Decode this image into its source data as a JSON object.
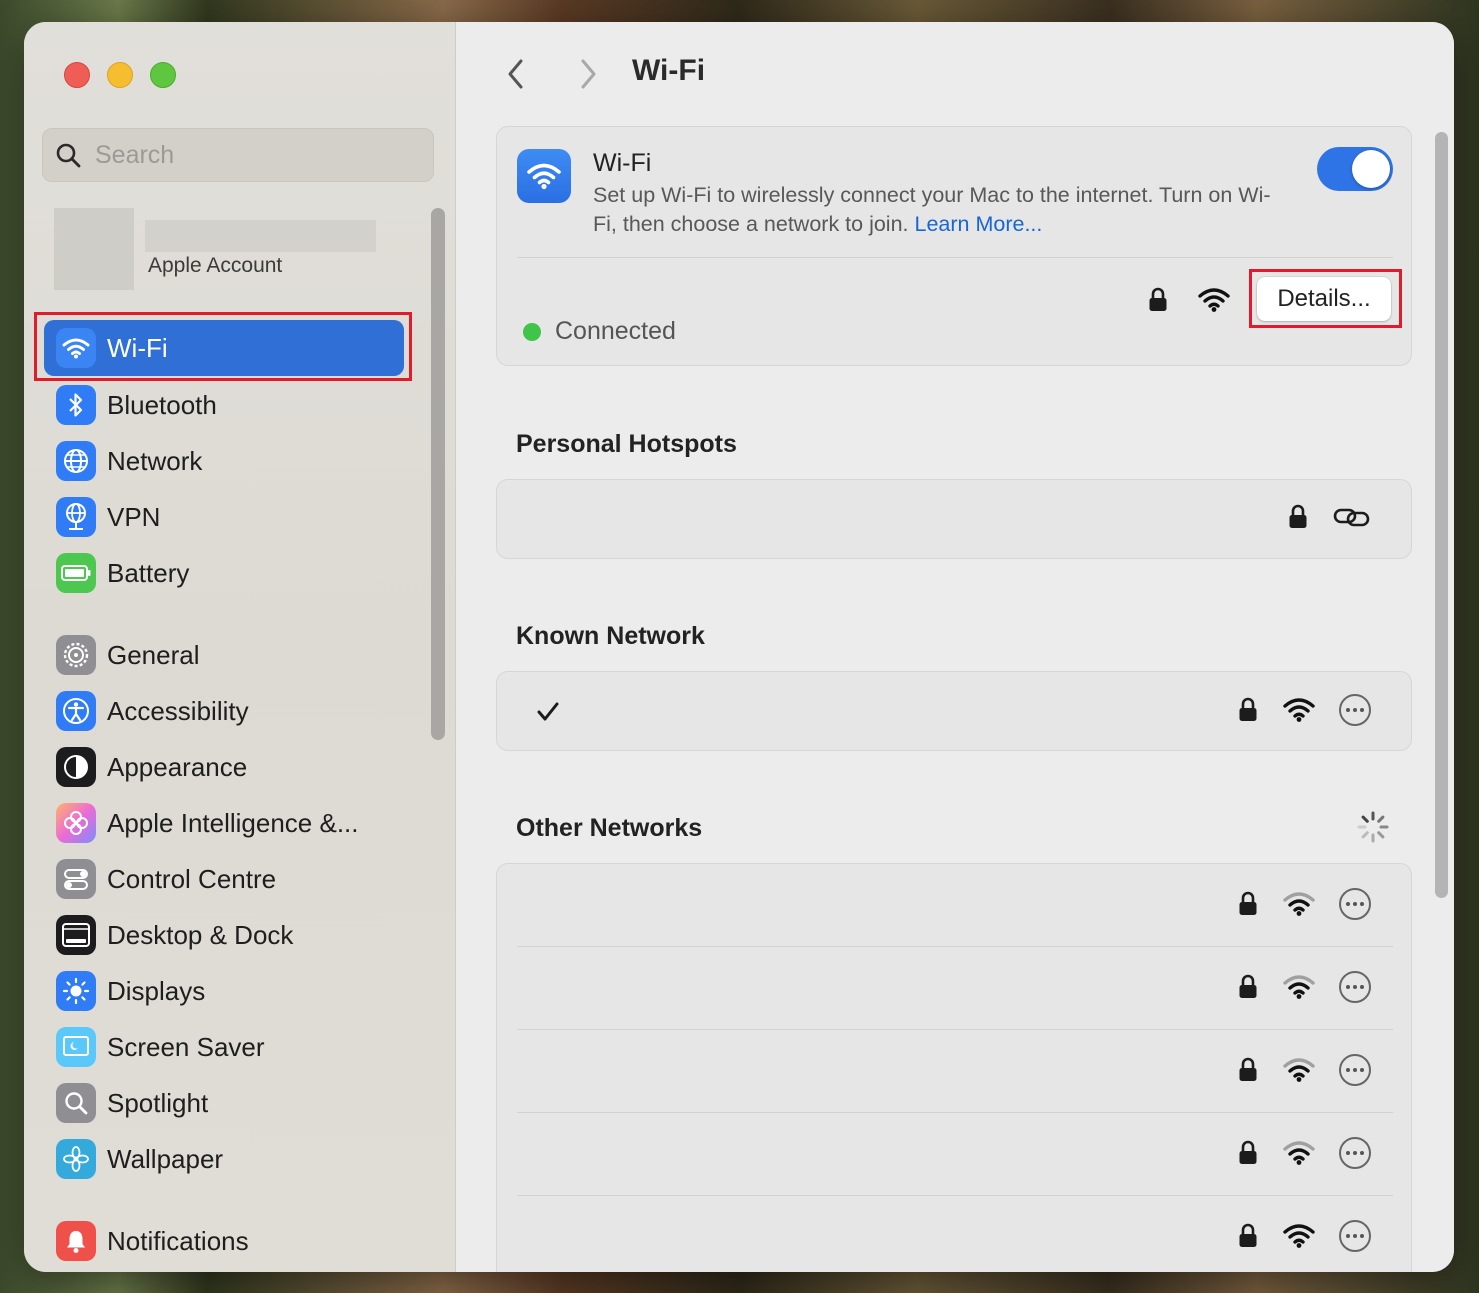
{
  "window": {
    "title": "Wi-Fi"
  },
  "sidebar": {
    "search_placeholder": "Search",
    "account_label": "Apple Account",
    "items": [
      {
        "label": "Wi-Fi",
        "icon": "wifi-icon",
        "color": "#2f7cf6"
      },
      {
        "label": "Bluetooth",
        "icon": "bluetooth-icon",
        "color": "#2f7cf6"
      },
      {
        "label": "Network",
        "icon": "globe-icon",
        "color": "#2f7cf6"
      },
      {
        "label": "VPN",
        "icon": "vpn-globe-icon",
        "color": "#2f7cf6"
      },
      {
        "label": "Battery",
        "icon": "battery-icon",
        "color": "#4cc850"
      },
      {
        "label": "General",
        "icon": "gear-icon",
        "color": "#8e8e93"
      },
      {
        "label": "Accessibility",
        "icon": "accessibility-icon",
        "color": "#2f7cf6"
      },
      {
        "label": "Appearance",
        "icon": "appearance-icon",
        "color": "#1c1c1e"
      },
      {
        "label": "Apple Intelligence &...",
        "icon": "apple-intelligence-icon",
        "color": "#e76bd0"
      },
      {
        "label": "Control Centre",
        "icon": "control-centre-icon",
        "color": "#8e8e93"
      },
      {
        "label": "Desktop & Dock",
        "icon": "desktop-dock-icon",
        "color": "#1c1c1e"
      },
      {
        "label": "Displays",
        "icon": "displays-icon",
        "color": "#2f7cf6"
      },
      {
        "label": "Screen Saver",
        "icon": "screen-saver-icon",
        "color": "#5ac8fa"
      },
      {
        "label": "Spotlight",
        "icon": "spotlight-icon",
        "color": "#8e8e93"
      },
      {
        "label": "Wallpaper",
        "icon": "wallpaper-icon",
        "color": "#34aadc"
      },
      {
        "label": "Notifications",
        "icon": "notifications-icon",
        "color": "#f0504a"
      }
    ],
    "selected": "Wi-Fi"
  },
  "main": {
    "title": "Wi-Fi",
    "wifi_card": {
      "title": "Wi-Fi",
      "description": "Set up Wi-Fi to wirelessly connect your Mac to the internet. Turn on Wi-Fi, then choose a network to join.",
      "learn_more": "Learn More...",
      "toggle_on": true,
      "status": "Connected",
      "details_button": "Details..."
    },
    "sections": {
      "personal_hotspots": "Personal Hotspots",
      "known_network": "Known Network",
      "other_networks": "Other Networks"
    },
    "other_networks_count_rows": 5
  },
  "colors": {
    "accent": "#2f6fd6",
    "connected": "#3ec54a",
    "highlight_box": "#e21b2c"
  }
}
